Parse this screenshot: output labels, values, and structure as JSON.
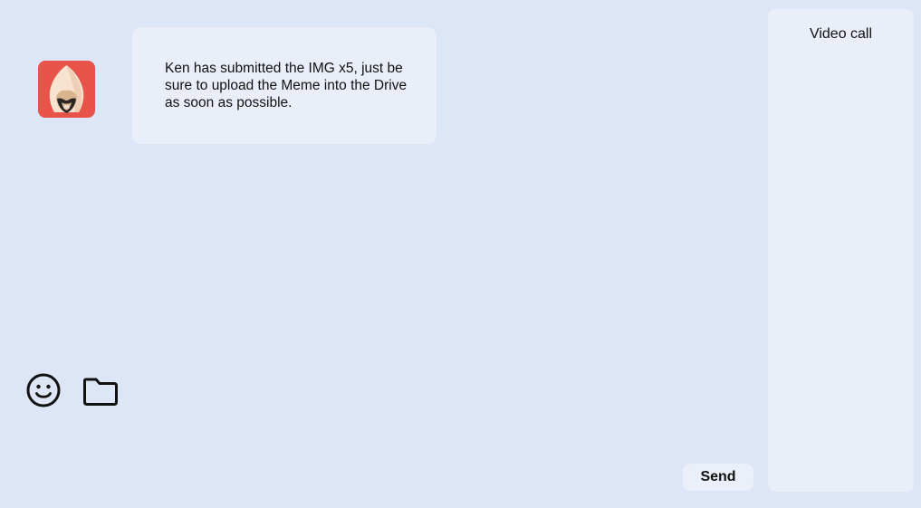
{
  "chat": {
    "message": {
      "text": "Ken has submitted the IMG x5, just be sure to upload the Meme into the Drive as soon as possible.",
      "avatar_icon": "hooded-assassin-avatar",
      "avatar_color": "#e8534a"
    }
  },
  "composer": {
    "emoji_icon": "smiley-icon",
    "attach_icon": "folder-icon",
    "send_label": "Send"
  },
  "side_panel": {
    "title": "Video call"
  },
  "colors": {
    "background": "#dde6f6",
    "surface": "#e9eef9"
  }
}
